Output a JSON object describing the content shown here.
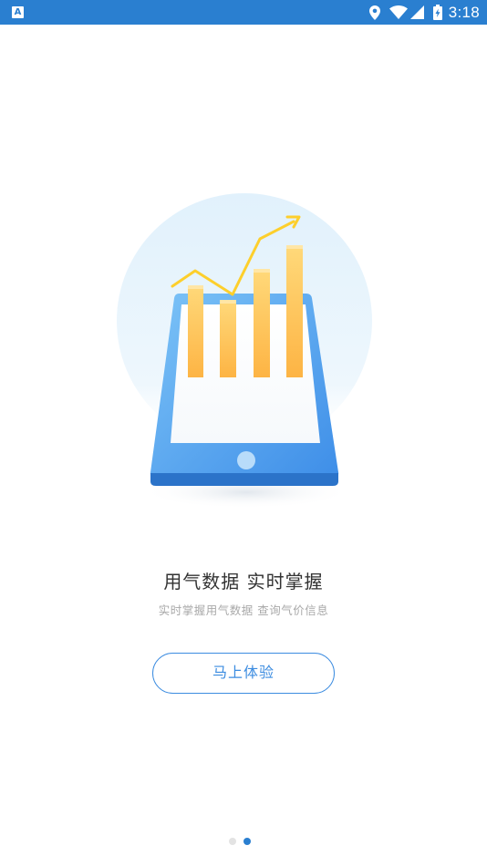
{
  "status_bar": {
    "app_icon_letter": "A",
    "time": "3:18",
    "icons": [
      "location-icon",
      "wifi-icon",
      "signal-icon",
      "battery-charging-icon"
    ],
    "background_color": "#2a7fd0"
  },
  "onboarding": {
    "headline": "用气数据  实时掌握",
    "subline": "实时掌握用气数据  查询气价信息",
    "cta_label": "马上体验",
    "accent_color": "#3c8ce0",
    "illustration_icon": "tablet-bar-chart-illustration"
  },
  "pager": {
    "page_count": 2,
    "active_index": 1
  }
}
